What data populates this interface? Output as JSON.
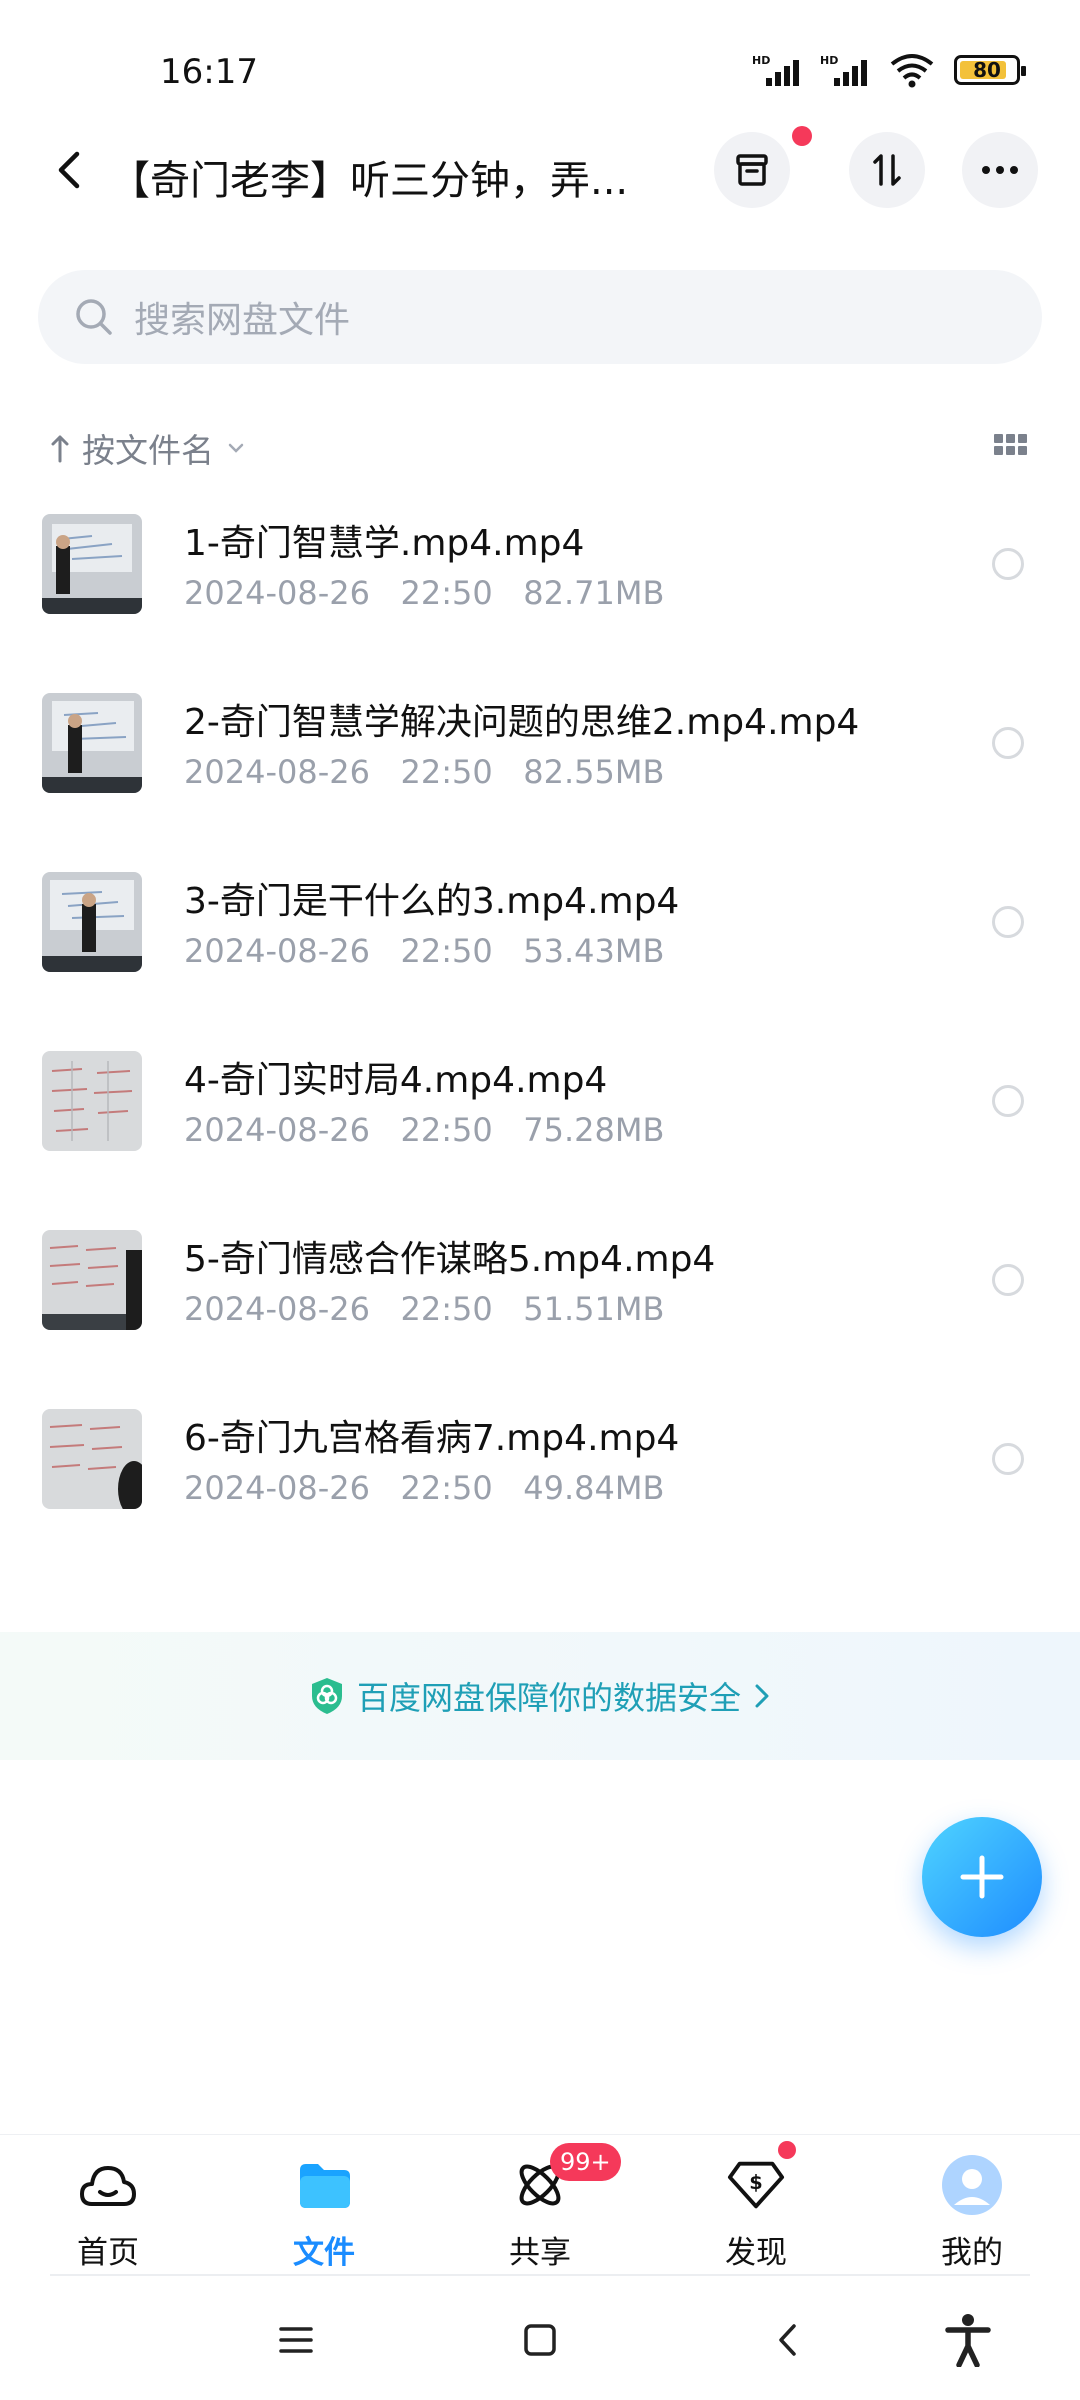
{
  "status_bar": {
    "time": "16:17",
    "battery": "80"
  },
  "header": {
    "title": "【奇门老李】听三分钟，弄..."
  },
  "search": {
    "placeholder": "搜索网盘文件"
  },
  "sort": {
    "label": "按文件名"
  },
  "files": [
    {
      "name": "1-奇门智慧学.mp4.mp4",
      "date": "2024-08-26",
      "time": "22:50",
      "size": "82.71MB",
      "thumb": "video-classroom"
    },
    {
      "name": "2-奇门智慧学解决问题的思维2.mp4.mp4",
      "date": "2024-08-26",
      "time": "22:50",
      "size": "82.55MB",
      "thumb": "video-classroom"
    },
    {
      "name": "3-奇门是干什么的3.mp4.mp4",
      "date": "2024-08-26",
      "time": "22:50",
      "size": "53.43MB",
      "thumb": "video-classroom"
    },
    {
      "name": "4-奇门实时局4.mp4.mp4",
      "date": "2024-08-26",
      "time": "22:50",
      "size": "75.28MB",
      "thumb": "video-whiteboard"
    },
    {
      "name": "5-奇门情感合作谋略5.mp4.mp4",
      "date": "2024-08-26",
      "time": "22:50",
      "size": "51.51MB",
      "thumb": "video-whiteboard"
    },
    {
      "name": "6-奇门九宫格看病7.mp4.mp4",
      "date": "2024-08-26",
      "time": "22:50",
      "size": "49.84MB",
      "thumb": "video-whiteboard"
    }
  ],
  "security_banner": {
    "text": "百度网盘保障你的数据安全"
  },
  "nav": [
    {
      "label": "首页",
      "icon": "cloud-home-icon"
    },
    {
      "label": "文件",
      "icon": "folder-icon",
      "active": true
    },
    {
      "label": "共享",
      "icon": "share-atom-icon",
      "badge": "99+"
    },
    {
      "label": "发现",
      "icon": "discover-diamond-icon"
    },
    {
      "label": "我的",
      "icon": "avatar-icon"
    }
  ],
  "colors": {
    "accent": "#1a8cff",
    "badge": "#f5395a",
    "security": "#1f9fb6"
  }
}
